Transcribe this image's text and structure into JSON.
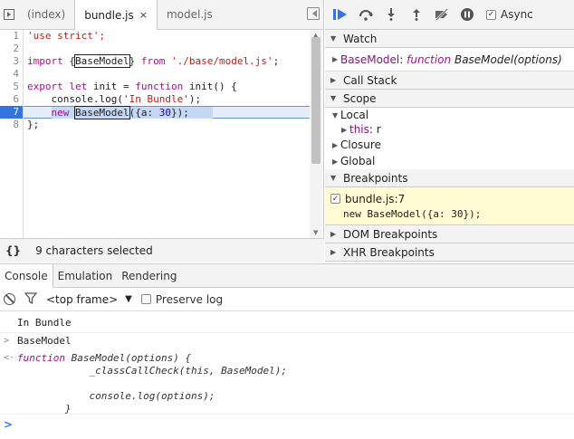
{
  "editor_tabs": [
    {
      "label": "(index)"
    },
    {
      "label": "bundle.js",
      "close": "×"
    },
    {
      "label": "model.js"
    }
  ],
  "code": {
    "line_numbers": [
      "1",
      "2",
      "3",
      "4",
      "5",
      "6",
      "7",
      "8"
    ],
    "lines": [
      {
        "parts": [
          {
            "t": "'use strict';",
            "c": "str"
          }
        ]
      },
      {
        "parts": []
      },
      {
        "parts": [
          {
            "t": "import ",
            "c": "kw"
          },
          {
            "t": "{",
            "c": "plain"
          },
          {
            "t": "BaseModel",
            "c": "plain boxed"
          },
          {
            "t": "} ",
            "c": "plain"
          },
          {
            "t": "from ",
            "c": "kw"
          },
          {
            "t": "'./base/model.js'",
            "c": "str"
          },
          {
            "t": ";",
            "c": "plain"
          }
        ]
      },
      {
        "parts": []
      },
      {
        "parts": [
          {
            "t": "export let ",
            "c": "kw"
          },
          {
            "t": "init = ",
            "c": "plain"
          },
          {
            "t": "function ",
            "c": "kw"
          },
          {
            "t": "init() {",
            "c": "plain"
          }
        ]
      },
      {
        "parts": [
          {
            "t": "    console.log(",
            "c": "plain"
          },
          {
            "t": "'In Bundle'",
            "c": "str"
          },
          {
            "t": ");",
            "c": "plain"
          }
        ]
      },
      {
        "parts": [
          {
            "t": "    ",
            "c": "plain"
          },
          {
            "t": "new ",
            "c": "kw sel"
          },
          {
            "t": "BaseModel",
            "c": "plain sel boxed"
          },
          {
            "t": "({a: ",
            "c": "plain sel"
          },
          {
            "t": "30",
            "c": "num sel"
          },
          {
            "t": "});",
            "c": "plain sel"
          },
          {
            "t": "    ",
            "c": "sel"
          }
        ]
      },
      {
        "parts": [
          {
            "t": "};",
            "c": "plain"
          }
        ]
      }
    ],
    "breakpoint_line": "7"
  },
  "status": {
    "brace": "{}",
    "text": "9 characters selected"
  },
  "debugger": {
    "async_label": "Async",
    "sections": {
      "watch": "Watch",
      "call_stack": "Call Stack",
      "scope": "Scope",
      "breakpoints": "Breakpoints",
      "dom_breakpoints": "DOM Breakpoints",
      "xhr_breakpoints": "XHR Breakpoints"
    },
    "watch_item": {
      "name": "BaseModel",
      "sep": ": ",
      "kw": "function",
      "sig": " BaseModel(options)"
    },
    "scope": {
      "local": "Local",
      "this_name": "this",
      "this_value": ": r",
      "closure": "Closure",
      "global": "Global"
    },
    "breakpoint": {
      "file": "bundle.js:7",
      "code": "new BaseModel({a: 30});"
    }
  },
  "console": {
    "tabs": [
      "Console",
      "Emulation",
      "Rendering"
    ],
    "frame": "<top frame>",
    "preserve_label": "Preserve log",
    "messages": [
      {
        "prefix": "",
        "text": "In Bundle",
        "italic": false
      },
      {
        "prefix": ">",
        "text": "BaseModel",
        "italic": false
      },
      {
        "prefix": "<·",
        "text": "function BaseModel(options) {\n            _classCallCheck(this, BaseModel);\n\n            console.log(options);\n        }",
        "italic": true
      }
    ],
    "prompt": ">"
  }
}
